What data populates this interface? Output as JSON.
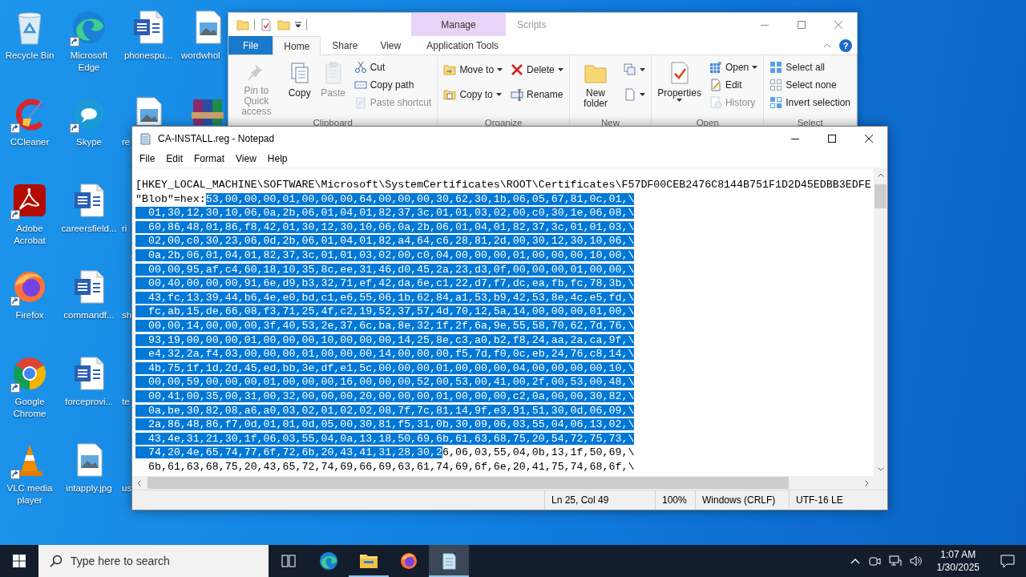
{
  "desktop_icons": [
    {
      "label": "Recycle Bin",
      "shortcut": false,
      "cut_off": false
    },
    {
      "label": "CCleaner",
      "shortcut": true,
      "cut_off": false
    },
    {
      "label": "Adobe Acrobat",
      "shortcut": true,
      "cut_off": false
    },
    {
      "label": "Firefox",
      "shortcut": true,
      "cut_off": false
    },
    {
      "label": "Google Chrome",
      "shortcut": true,
      "cut_off": false
    },
    {
      "label": "VLC media player",
      "shortcut": true,
      "cut_off": false
    },
    {
      "label": "Microsoft Edge",
      "shortcut": true,
      "cut_off": false
    },
    {
      "label": "Skype",
      "shortcut": true,
      "cut_off": false
    },
    {
      "label": "careersfield...",
      "shortcut": false,
      "cut_off": false
    },
    {
      "label": "commandf...",
      "shortcut": false,
      "cut_off": false
    },
    {
      "label": "forceprovi...",
      "shortcut": false,
      "cut_off": false
    },
    {
      "label": "intapply.jpg",
      "shortcut": false,
      "cut_off": false
    },
    {
      "label": "phonespu...",
      "shortcut": false,
      "cut_off": false
    },
    {
      "label": "re",
      "shortcut": false,
      "cut_off": true
    },
    {
      "label": "ri",
      "cut_off": true
    },
    {
      "label": "sh",
      "cut_off": true
    },
    {
      "label": "te",
      "cut_off": true
    },
    {
      "label": "us",
      "cut_off": true
    },
    {
      "label": "wordwhol",
      "shortcut": false,
      "cut_off": true
    },
    {
      "shortcut": false
    }
  ],
  "explorer": {
    "title": "Scripts",
    "context_header": "Manage",
    "help": "?",
    "tabs": [
      {
        "label": "File",
        "kind": "file",
        "selected": false
      },
      {
        "label": "Home",
        "kind": "normal",
        "selected": true
      },
      {
        "label": "Share",
        "kind": "normal",
        "selected": false
      },
      {
        "label": "View",
        "kind": "normal",
        "selected": false
      },
      {
        "label": "Application Tools",
        "kind": "context",
        "selected": false
      }
    ],
    "groups": [
      {
        "label": "Clipboard",
        "columns": [
          {
            "kind": "large",
            "buttons": [
              {
                "label": "Pin to Quick access",
                "disabled": true
              }
            ]
          },
          {
            "kind": "large",
            "buttons": [
              {
                "label": "Copy",
                "disabled": false
              }
            ]
          },
          {
            "kind": "large",
            "buttons": [
              {
                "label": "Paste",
                "disabled": true
              }
            ]
          },
          {
            "kind": "small",
            "buttons": [
              {
                "label": "Cut",
                "disabled": false
              },
              {
                "label": "Copy path",
                "disabled": false
              },
              {
                "label": "Paste shortcut",
                "disabled": true
              }
            ]
          }
        ]
      },
      {
        "label": "Organize",
        "columns": [
          {
            "kind": "small",
            "buttons": [
              {
                "label": "Move to",
                "disabled": false,
                "dropdown": true
              },
              {
                "label": "Copy to",
                "disabled": false,
                "dropdown": true
              }
            ]
          },
          {
            "kind": "small",
            "buttons": [
              {
                "label": "Delete",
                "disabled": false,
                "dropdown": true
              },
              {
                "label": "Rename",
                "disabled": false
              }
            ]
          }
        ]
      },
      {
        "label": "New",
        "columns": [
          {
            "kind": "large",
            "buttons": [
              {
                "label": "New folder",
                "disabled": false
              }
            ]
          },
          {
            "kind": "small",
            "buttons": [
              {
                "disabled": false,
                "dropdown": true
              },
              {
                "disabled": false,
                "dropdown": true
              }
            ]
          }
        ]
      },
      {
        "label": "Open",
        "columns": [
          {
            "kind": "large",
            "buttons": [
              {
                "label": "Properties",
                "disabled": false,
                "dropdown": true
              }
            ]
          },
          {
            "kind": "small",
            "buttons": [
              {
                "label": "Open",
                "disabled": false,
                "dropdown": true
              },
              {
                "label": "Edit",
                "disabled": false
              },
              {
                "label": "History",
                "disabled": true
              }
            ]
          }
        ]
      },
      {
        "label": "Select",
        "columns": [
          {
            "kind": "small",
            "buttons": [
              {
                "label": "Select all",
                "disabled": false
              },
              {
                "label": "Select none",
                "disabled": false
              },
              {
                "label": "Invert selection",
                "disabled": false
              }
            ]
          }
        ]
      }
    ]
  },
  "notepad": {
    "title": "CA-INSTALL.reg - Notepad",
    "menu": [
      "File",
      "Edit",
      "Format",
      "View",
      "Help"
    ],
    "lines": [
      {
        "segments": [
          {
            "text": "[HKEY_LOCAL_MACHINE\\SOFTWARE\\Microsoft\\SystemCertificates\\ROOT\\Certificates\\F57DF00CEB2476C8144B751F1D2D45EDBB3EDFE",
            "selected": false
          }
        ]
      },
      {
        "segments": [
          {
            "text": "\"Blob\"=hex:",
            "selected": false
          },
          {
            "text": "53,00,00,00,01,00,00,00,64,00,00,00,30,62,30,1b,06,05,67,81,0c,01,\\",
            "selected": true
          }
        ]
      },
      {
        "segments": [
          {
            "text": "  01,30,12,30,10,06,0a,2b,06,01,04,01,82,37,3c,01,01,03,02,00,c0,30,1e,06,08,\\",
            "selected": true
          }
        ]
      },
      {
        "segments": [
          {
            "text": "  60,86,48,01,86,f8,42,01,30,12,30,10,06,0a,2b,06,01,04,01,82,37,3c,01,01,03,\\",
            "selected": true
          }
        ]
      },
      {
        "segments": [
          {
            "text": "  02,00,c0,30,23,06,0d,2b,06,01,04,01,82,a4,64,c6,28,81,2d,00,30,12,30,10,06,\\",
            "selected": true
          }
        ]
      },
      {
        "segments": [
          {
            "text": "  0a,2b,06,01,04,01,82,37,3c,01,01,03,02,00,c0,04,00,00,00,01,00,00,00,10,00,\\",
            "selected": true
          }
        ]
      },
      {
        "segments": [
          {
            "text": "  00,00,95,af,c4,60,18,10,35,8c,ee,31,46,d0,45,2a,23,d3,0f,00,00,00,01,00,00,\\",
            "selected": true
          }
        ]
      },
      {
        "segments": [
          {
            "text": "  00,40,00,00,00,91,6e,d9,b3,32,71,ef,42,da,6e,c1,22,d7,f7,dc,ea,fb,fc,78,3b,\\",
            "selected": true
          }
        ]
      },
      {
        "segments": [
          {
            "text": "  43,fc,13,39,44,b6,4e,e0,bd,c1,e6,55,06,1b,62,84,a1,53,b9,42,53,8e,4c,e5,fd,\\",
            "selected": true
          }
        ]
      },
      {
        "segments": [
          {
            "text": "  fc,ab,15,de,66,08,f3,71,25,4f,c2,19,52,37,57,4d,70,12,5a,14,00,00,00,01,00,\\",
            "selected": true
          }
        ]
      },
      {
        "segments": [
          {
            "text": "  00,00,14,00,00,00,3f,40,53,2e,37,6c,ba,8e,32,1f,2f,6a,9e,55,58,70,62,7d,76,\\",
            "selected": true
          }
        ]
      },
      {
        "segments": [
          {
            "text": "  93,19,00,00,00,01,00,00,00,10,00,00,00,14,25,8e,c3,a0,b2,f8,24,aa,2a,ca,9f,\\",
            "selected": true
          }
        ]
      },
      {
        "segments": [
          {
            "text": "  e4,32,2a,f4,03,00,00,00,01,00,00,00,14,00,00,00,f5,7d,f0,0c,eb,24,76,c8,14,\\",
            "selected": true
          }
        ]
      },
      {
        "segments": [
          {
            "text": "  4b,75,1f,1d,2d,45,ed,bb,3e,df,e1,5c,00,00,00,01,00,00,00,04,00,00,00,00,10,\\",
            "selected": true
          }
        ]
      },
      {
        "segments": [
          {
            "text": "  00,00,59,00,00,00,01,00,00,00,16,00,00,00,52,00,53,00,41,00,2f,00,53,00,48,\\",
            "selected": true
          }
        ]
      },
      {
        "segments": [
          {
            "text": "  00,41,00,35,00,31,00,32,00,00,00,20,00,00,00,01,00,00,00,c2,0a,00,00,30,82,\\",
            "selected": true
          }
        ]
      },
      {
        "segments": [
          {
            "text": "  0a,be,30,82,08,a6,a0,03,02,01,02,02,08,7f,7c,81,14,9f,e3,91,51,30,0d,06,09,\\",
            "selected": true
          }
        ]
      },
      {
        "segments": [
          {
            "text": "  2a,86,48,86,f7,0d,01,01,0d,05,00,30,81,f5,31,0b,30,09,06,03,55,04,06,13,02,\\",
            "selected": true
          }
        ]
      },
      {
        "segments": [
          {
            "text": "  43,4e,31,21,30,1f,06,03,55,04,0a,13,18,50,69,6b,61,63,68,75,20,54,72,75,73,\\",
            "selected": true
          }
        ]
      },
      {
        "segments": [
          {
            "text": "  74,20,4e,65,74,77,6f,72,6b,20,43,41,31,28,30,2",
            "selected": true
          },
          {
            "text": "6,06,03,55,04,0b,13,1f,50,69,\\",
            "selected": false
          }
        ]
      },
      {
        "segments": [
          {
            "text": "  6b,61,63,68,75,20,43,65,72,74,69,66,69,63,61,74,69,6f,6e,20,41,75,74,68,6f,\\",
            "selected": false
          }
        ]
      }
    ],
    "status": [
      "Ln 25, Col 49",
      "100%",
      "Windows (CRLF)",
      "UTF-16 LE"
    ]
  },
  "taskbar": {
    "search": {
      "placeholder": "Type here to search"
    },
    "apps": [
      {
        "running": false,
        "selected": false
      },
      {
        "running": true,
        "selected": false
      },
      {
        "running": false,
        "selected": false
      },
      {
        "running": true,
        "selected": true
      }
    ],
    "clock": {
      "time": "1:07 AM",
      "date": "1/30/2025"
    }
  }
}
